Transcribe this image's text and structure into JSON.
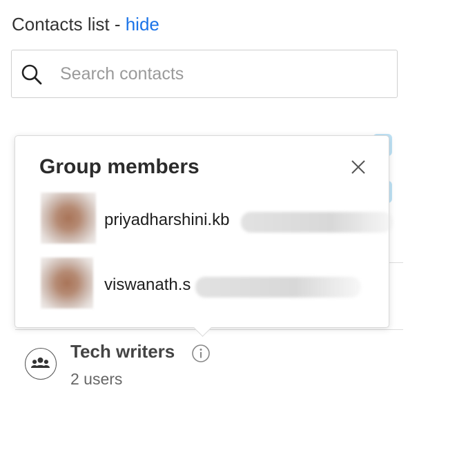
{
  "header": {
    "title": "Contacts list - ",
    "hide_link": "hide"
  },
  "search": {
    "placeholder": "Search contacts",
    "value": "",
    "icon": "search-icon"
  },
  "popup": {
    "title": "Group members",
    "close_icon": "close-icon",
    "members": [
      {
        "name": "priyadharshini.kb",
        "avatar": "blurred-photo"
      },
      {
        "name": "viswanath.s",
        "avatar": "blurred-photo"
      }
    ]
  },
  "group": {
    "name": "Tech writers",
    "count": "2 users",
    "icon": "group-icon",
    "info_icon": "info-icon"
  },
  "colors": {
    "link": "#1a73e8",
    "accent_tab": "#bfe3f6"
  }
}
